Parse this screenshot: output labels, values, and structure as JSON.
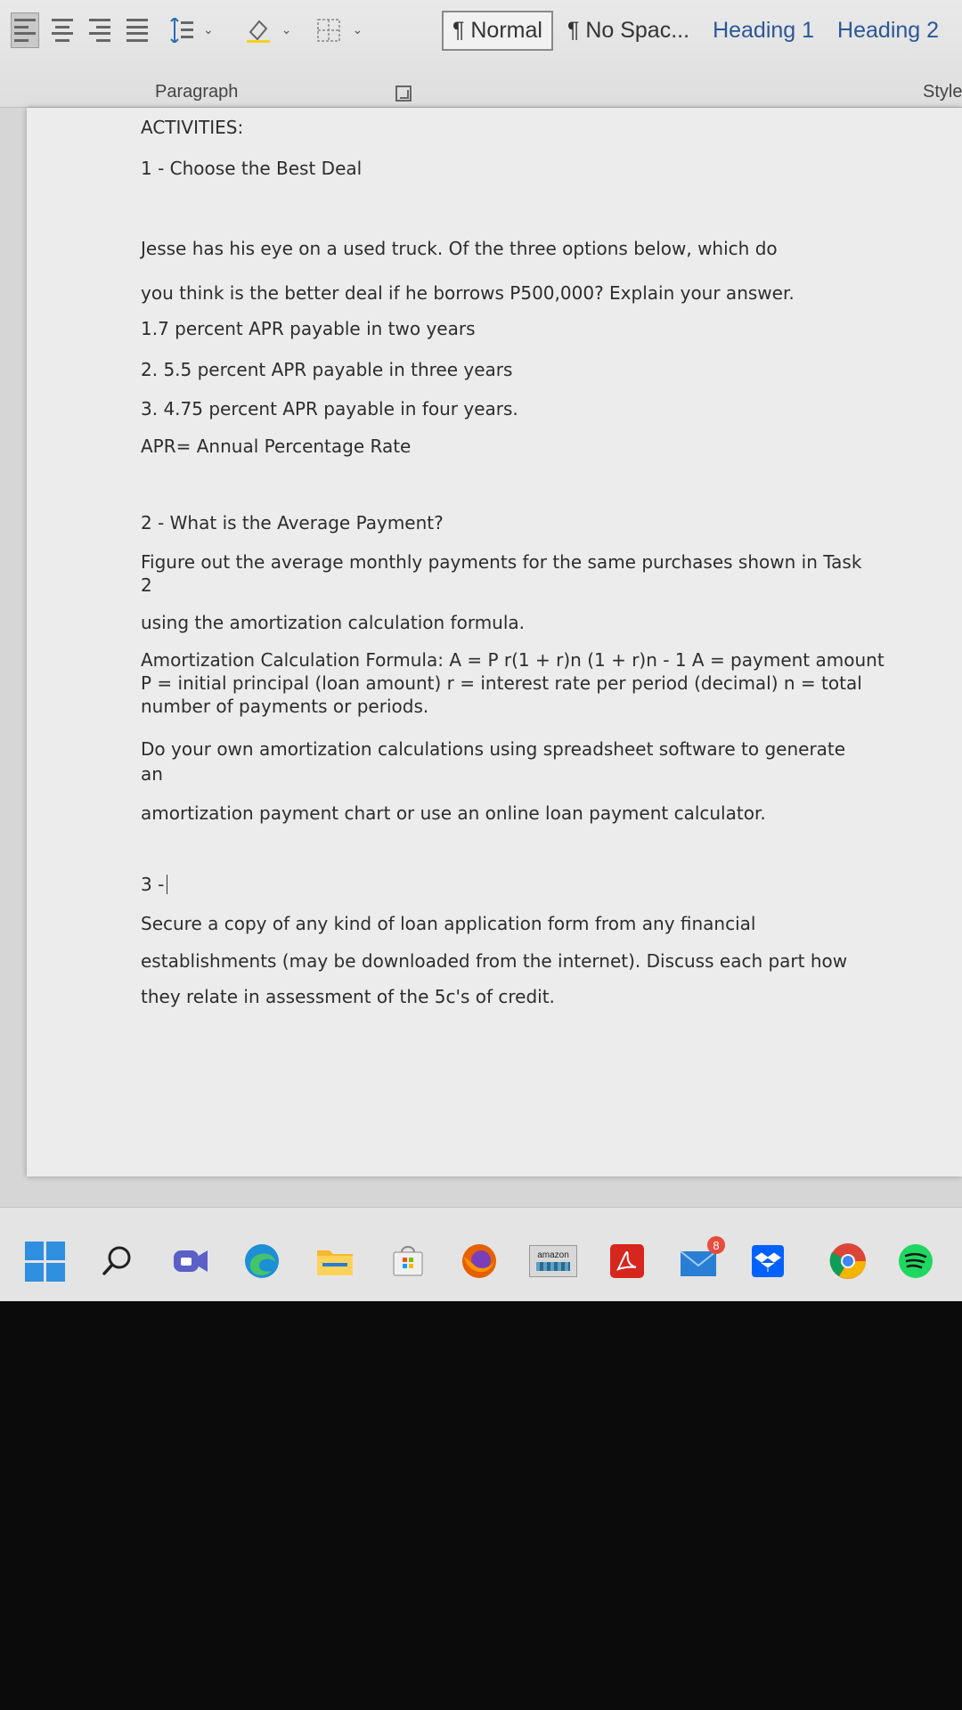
{
  "ribbon": {
    "styles": [
      "¶ Normal",
      "¶ No Spac...",
      "Heading 1",
      "Heading 2"
    ],
    "paragraph_label": "Paragraph",
    "styles_label": "Style",
    "icons": [
      "align-left-icon",
      "align-center-icon",
      "align-right-icon",
      "justify-icon",
      "line-spacing-icon",
      "shading-icon",
      "borders-icon",
      "dialog-launcher-icon"
    ]
  },
  "document": {
    "heading": "ACTIVITIES:",
    "activity1_title": "1 - Choose the Best Deal",
    "a1_line1": "Jesse has his eye on a used truck. Of the three options below, which do",
    "a1_line2": "you think is the better deal if he borrows P500,000? Explain your answer.",
    "option1": "1.7 percent APR payable in two years",
    "option2": "2. 5.5 percent APR payable in three years",
    "option3": "3. 4.75 percent APR payable in four years.",
    "apr_def": "APR= Annual Percentage Rate",
    "activity2_title": "2 - What is the Average Payment?",
    "a2_line1": "Figure out the average monthly payments for the same purchases shown in Task",
    "a2_line2": "2",
    "a2_line3": "using the amortization calculation formula.",
    "formula_line1": "Amortization Calculation Formula: A = P r(1 + r)n (1 + r)n - 1 A = payment amount",
    "formula_line2": "P = initial principal (loan amount) r = interest rate per period (decimal) n = total",
    "formula_line3": "number of payments or periods.",
    "a2_line4": "Do your own amortization calculations using spreadsheet software to generate",
    "a2_line5": "an",
    "a2_line6": "amortization payment chart or use an online loan payment calculator.",
    "activity3_title": "3 -",
    "a3_line1": "Secure a copy of any kind of loan application form from any financial",
    "a3_line2": "establishments (may be downloaded from the internet). Discuss each part how",
    "a3_line3": "they relate in assessment of the 5c's of credit."
  },
  "taskbar": {
    "apps": [
      "windows-start",
      "search",
      "teams",
      "edge",
      "file-explorer",
      "microsoft-store",
      "firefox",
      "amazon",
      "acrobat",
      "mail",
      "dropbox",
      "chrome",
      "spotify"
    ],
    "amazon_label": "amazon",
    "mail_badge": "8"
  },
  "colors": {
    "accent": "#2b5797",
    "windows_blue": "#2f8fe0",
    "page": "#ececec"
  }
}
